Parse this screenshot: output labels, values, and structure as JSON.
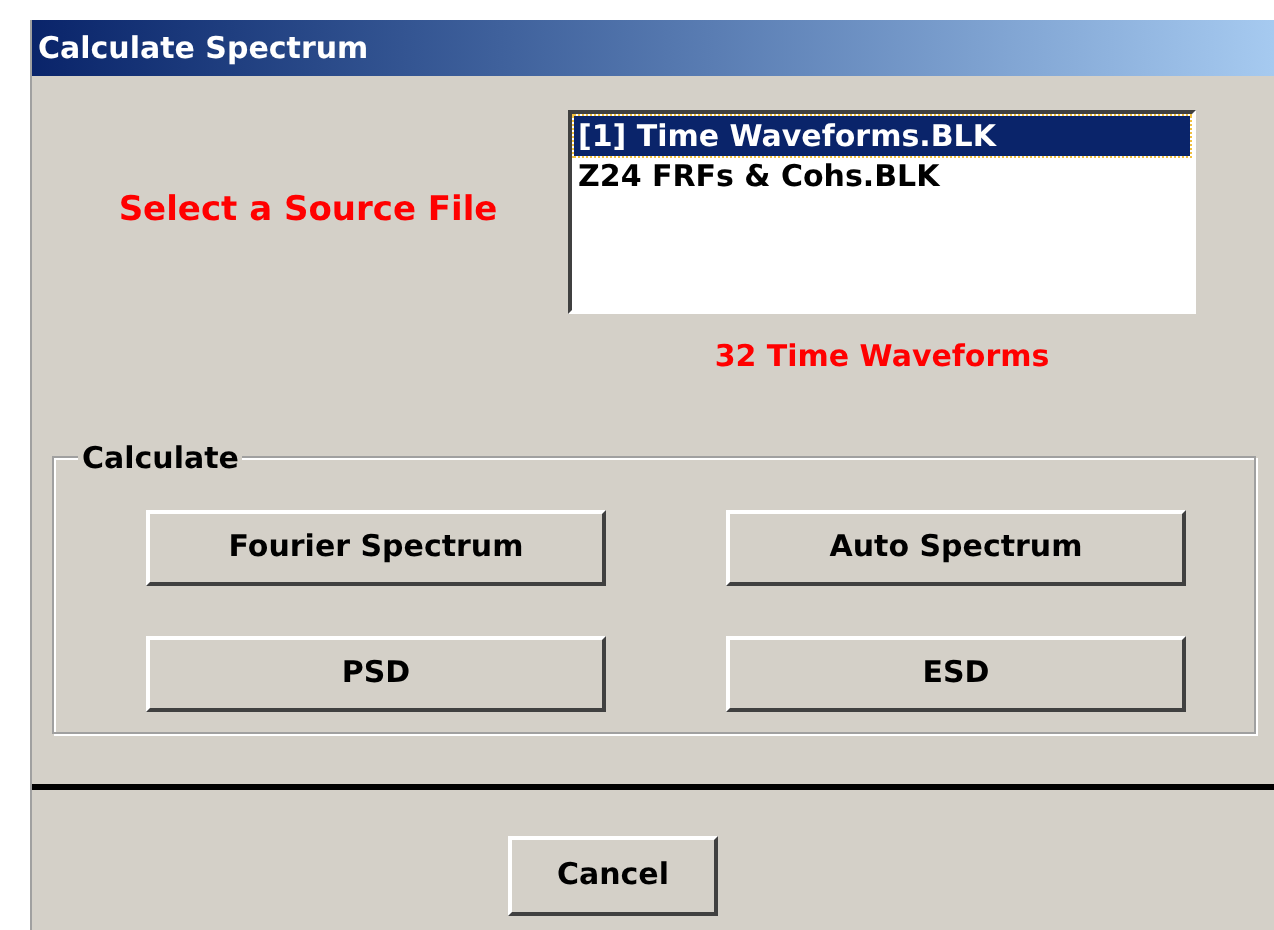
{
  "window": {
    "title": "Calculate Spectrum"
  },
  "source_label": "Select a Source File",
  "files": [
    {
      "name": "[1] Time Waveforms.BLK",
      "selected": true
    },
    {
      "name": "Z24 FRFs & Cohs.BLK",
      "selected": false
    }
  ],
  "file_summary": "32 Time Waveforms",
  "calculate_group": {
    "title": "Calculate",
    "buttons": [
      "Fourier Spectrum",
      "Auto Spectrum",
      "PSD",
      "ESD"
    ]
  },
  "buttons": [
    "Cancel"
  ]
}
